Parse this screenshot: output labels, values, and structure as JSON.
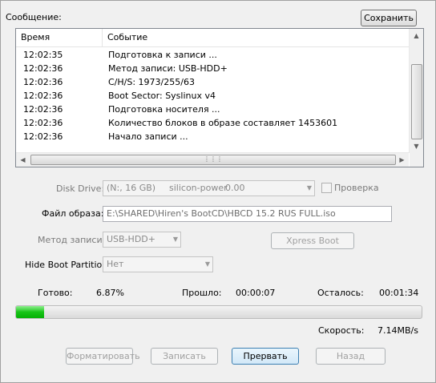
{
  "message_label": "Сообщение:",
  "save_button": "Сохранить",
  "log": {
    "columns": [
      "Время",
      "Событие"
    ],
    "rows": [
      {
        "time": "12:02:35",
        "event": "Подготовка к записи ..."
      },
      {
        "time": "12:02:36",
        "event": "Метод записи: USB-HDD+"
      },
      {
        "time": "12:02:36",
        "event": "C/H/S: 1973/255/63"
      },
      {
        "time": "12:02:36",
        "event": "Boot Sector: Syslinux v4"
      },
      {
        "time": "12:02:36",
        "event": "Подготовка носителя ..."
      },
      {
        "time": "12:02:36",
        "event": "Количество блоков в образе составляет 1453601"
      },
      {
        "time": "12:02:36",
        "event": "Начало записи ..."
      }
    ]
  },
  "disk_drive": {
    "label": "Disk Drive:",
    "value": "(N:, 16 GB)",
    "vendor": "silicon-power",
    "size": "0.00"
  },
  "verify": {
    "label": "Проверка",
    "checked": false
  },
  "image_file": {
    "label": "Файл образа:",
    "value": "E:\\SHARED\\Hiren's BootCD\\HBCD 15.2 RUS FULL.iso"
  },
  "write_method": {
    "label": "Метод записи:",
    "value": "USB-HDD+"
  },
  "xpress_boot_button": "Xpress Boot",
  "hide_boot_partition": {
    "label": "Hide Boot Partition:",
    "value": "Нет"
  },
  "status": {
    "done_label": "Готово:",
    "done_value": "6.87%",
    "elapsed_label": "Прошло:",
    "elapsed_value": "00:00:07",
    "remaining_label": "Осталось:",
    "remaining_value": "00:01:34",
    "speed_label": "Скорость:",
    "speed_value": "7.14MB/s"
  },
  "progress_fraction": 0.0687,
  "buttons": {
    "format": "Форматировать",
    "write": "Записать",
    "abort": "Прервать",
    "back": "Назад"
  },
  "icons": {
    "dropdown": "chevron-down-icon",
    "scroll_up": "arrow-up-icon",
    "scroll_down": "arrow-down-icon",
    "scroll_left": "arrow-left-icon",
    "scroll_right": "arrow-right-icon"
  },
  "colors": {
    "progress_fill": "#17c417",
    "window_bg": "#f0f0f0"
  }
}
